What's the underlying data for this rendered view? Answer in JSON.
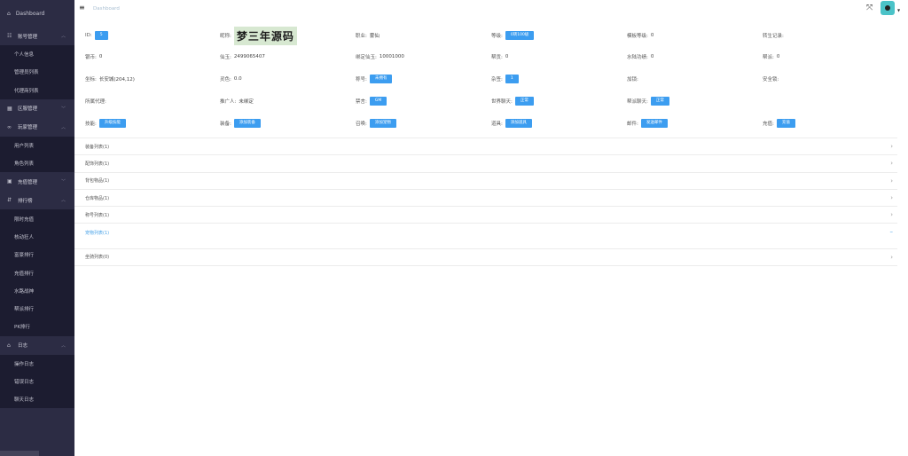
{
  "sidebar": {
    "brand": "Dashboard",
    "groups": [
      {
        "label": "账号管理",
        "items": [
          "个人信息",
          "管理员列表",
          "代理商列表"
        ]
      },
      {
        "label": "区服管理",
        "items": []
      },
      {
        "label": "玩家管理",
        "items": [
          "用户列表",
          "角色列表"
        ]
      },
      {
        "label": "充值管理",
        "items": []
      },
      {
        "label": "排行榜",
        "items": [
          "限时充值",
          "核动狂人",
          "富豪排行",
          "充值排行",
          "水路战神",
          "帮派排行",
          "PK排行"
        ]
      },
      {
        "label": "日志",
        "items": [
          "操作日志",
          "错误日志",
          "聊天日志"
        ]
      }
    ]
  },
  "header": {
    "breadcrumb": "Dashboard"
  },
  "info": {
    "row1": {
      "id_label": "ID:",
      "id_value": "5",
      "nick_label": "昵称:",
      "nick_value": "梦三年源码",
      "job_label": "职业:",
      "job_value": "雾仙",
      "level_label": "等级:",
      "level_value": "0转100级",
      "mo_label": "模板等级:",
      "mo_value": "0",
      "rebirth_label": "转生记录:"
    },
    "row2": {
      "silver_label": "银币:",
      "silver_value": "0",
      "jade_label": "仙玉:",
      "jade_value": "2499065407",
      "bind_label": "绑定仙玉:",
      "bind_value": "10001000",
      "gang_label": "帮贡:",
      "gang_value": "0",
      "water_label": "水陆功绩:",
      "water_value": "0",
      "help_label": "帮派:",
      "help_value": "0"
    },
    "row3": {
      "coord_label": "坐标:",
      "coord_value": "长安城(204,12)",
      "charm_label": "灵色:",
      "charm_value": "0.0",
      "title_label": "称号:",
      "title_btn": "未拥有",
      "stamp_label": "杂签:",
      "stamp_btn": "1",
      "lock_label": "加锁:",
      "safe_label": "安全锁:"
    },
    "row4": {
      "agent_label": "所属代理:",
      "promo_label": "推广人:",
      "promo_value": "未绑定",
      "gm_label": "禁言:",
      "gm_btn": "GM",
      "world_label": "世界聊天:",
      "world_btn": "正常",
      "gangchat_label": "帮派聊天:",
      "gangchat_btn": "正常"
    },
    "row5": {
      "skill_label": "技能:",
      "skill_btn": "升级技能",
      "equip_label": "装备:",
      "equip_btn": "添加装备",
      "pet_label": "召唤:",
      "pet_btn": "添加宠物",
      "prop_label": "道具:",
      "prop_btn": "添加道具",
      "mail_label": "邮件:",
      "mail_btn": "发送邮件",
      "recharge_label": "充值:",
      "recharge_btn": "充值"
    }
  },
  "collapse": [
    {
      "label": "装备列表(1)",
      "active": false
    },
    {
      "label": "配饰列表(1)",
      "active": false
    },
    {
      "label": "背包物品(1)",
      "active": false
    },
    {
      "label": "仓库物品(1)",
      "active": false
    },
    {
      "label": "称号列表(1)",
      "active": false
    },
    {
      "label": "宠物列表(1)",
      "active": true
    },
    {
      "label": "坐骑列表(0)",
      "active": false
    }
  ]
}
